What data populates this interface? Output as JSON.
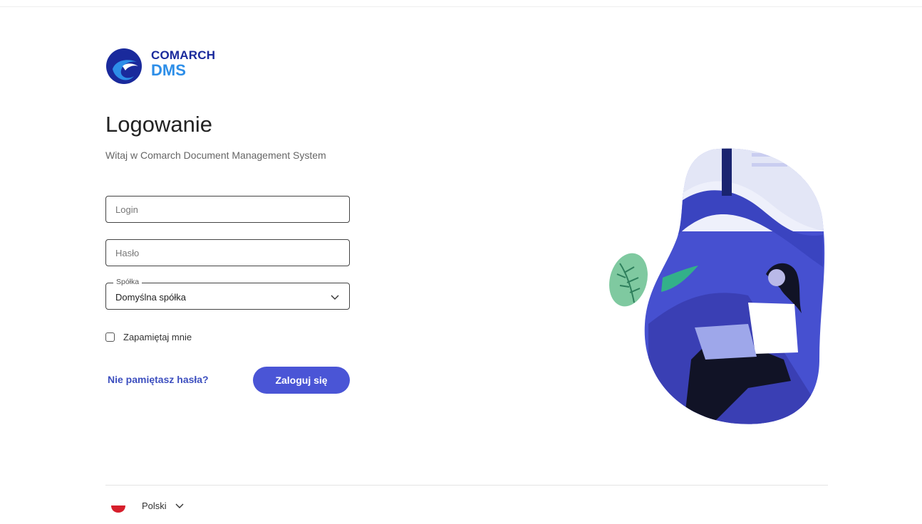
{
  "brand": {
    "company": "COMARCH",
    "product": "DMS",
    "logo_icon": "comarch-logo-icon"
  },
  "page": {
    "title": "Logowanie",
    "subtitle": "Witaj w Comarch Document Management System"
  },
  "form": {
    "login_placeholder": "Login",
    "login_value": "",
    "password_placeholder": "Hasło",
    "password_value": "",
    "company_label": "Spółka",
    "company_value": "Domyślna spółka",
    "remember_label": "Zapamiętaj mnie",
    "remember_checked": false,
    "forgot_label": "Nie pamiętasz hasła?",
    "submit_label": "Zaloguj się"
  },
  "footer": {
    "language_label": "Polski",
    "language_flag": "poland-flag-icon"
  },
  "colors": {
    "accent": "#4a55d6",
    "link": "#3d4fbf",
    "brand_dark": "#1a2a9c",
    "brand_light": "#2d8ee8"
  }
}
